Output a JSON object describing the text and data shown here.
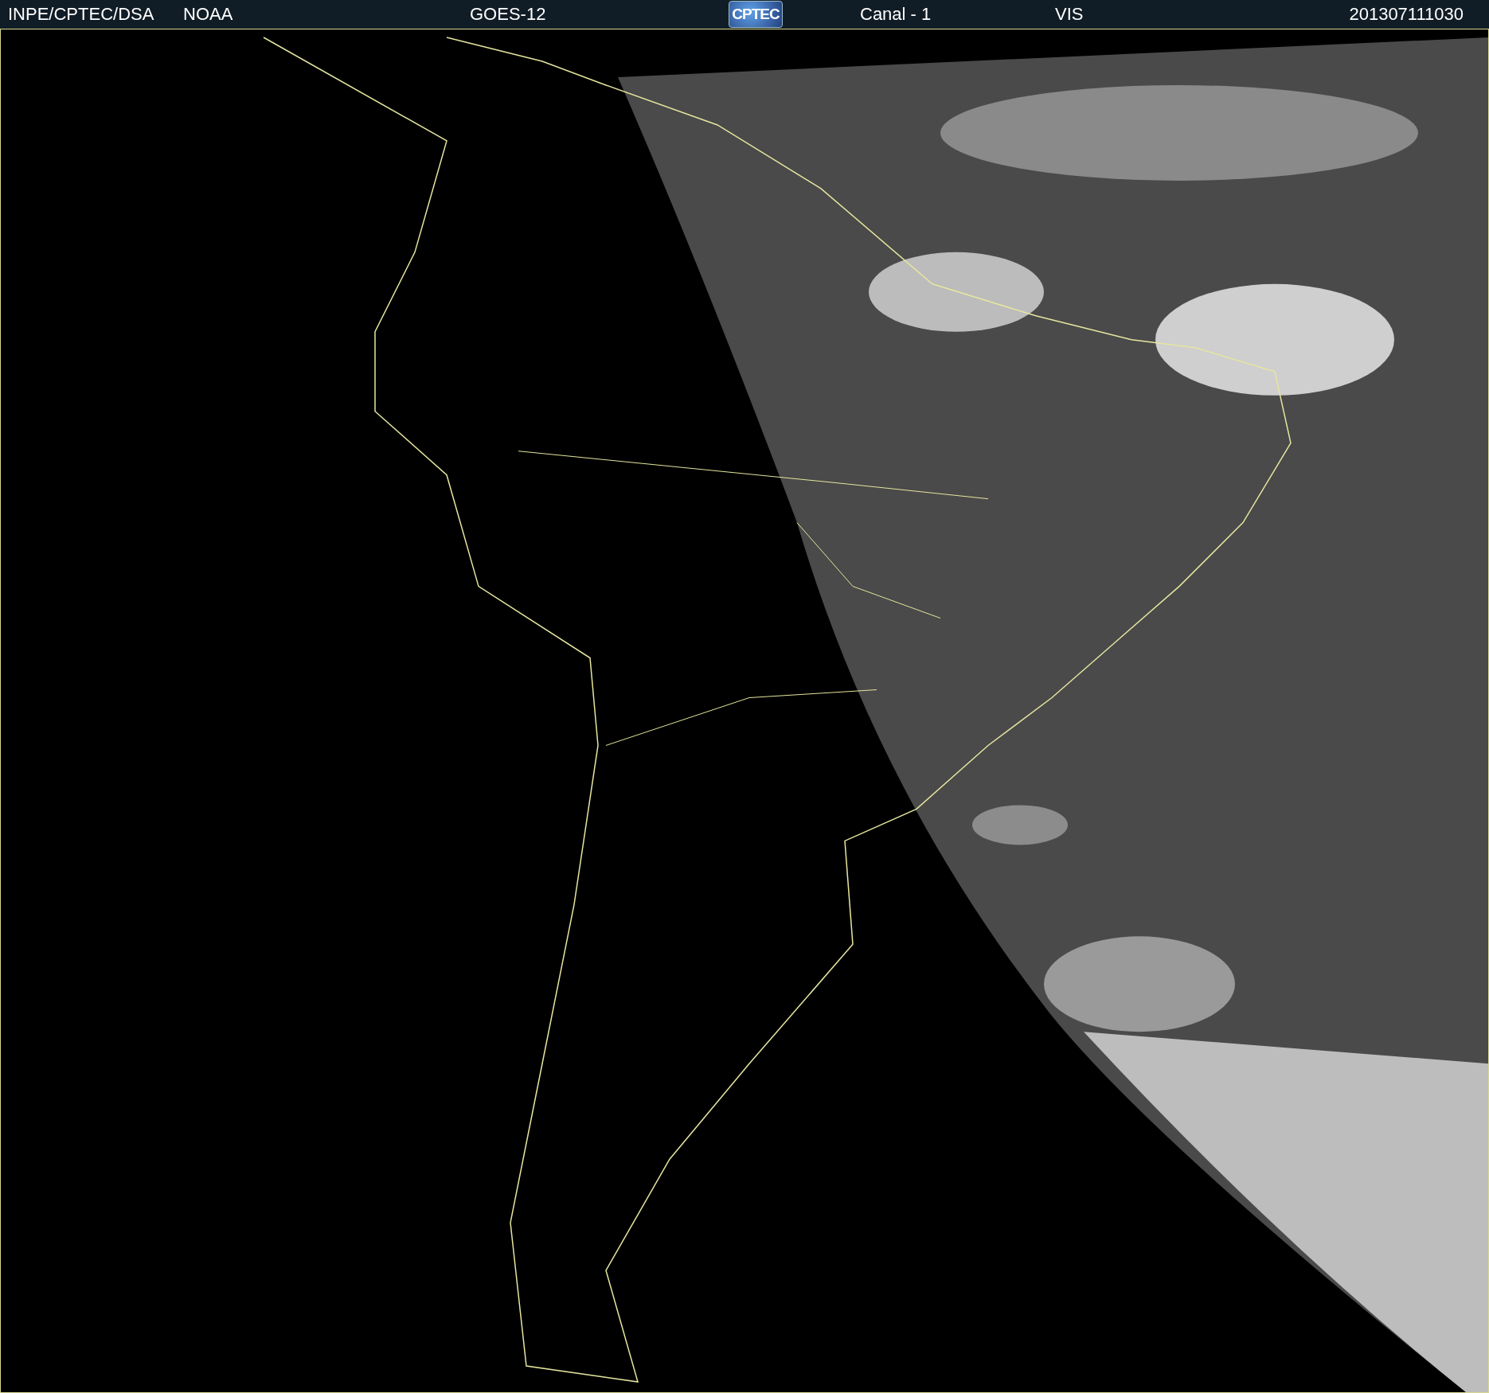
{
  "header": {
    "items": [
      {
        "kind": "text",
        "text": "INPE/CPTEC/DSA"
      },
      {
        "kind": "text",
        "text": "NOAA"
      },
      {
        "kind": "text",
        "text": "GOES-12"
      },
      {
        "kind": "logo",
        "text": "CPTEC"
      },
      {
        "kind": "text",
        "text": "Canal - 1"
      },
      {
        "kind": "text",
        "text": "VIS"
      },
      {
        "kind": "text",
        "text": "201307111030"
      }
    ]
  }
}
